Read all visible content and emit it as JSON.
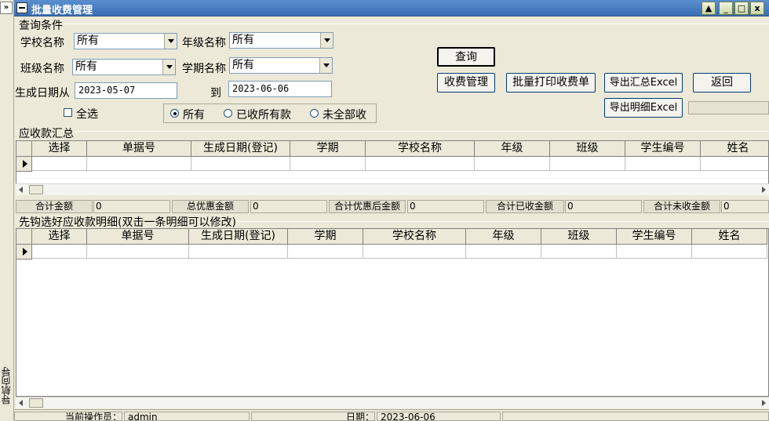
{
  "window": {
    "title": "批量收费管理",
    "nav_label": "导航向导",
    "nav_button": "»",
    "min": "_",
    "restore": "□",
    "close": "x",
    "help": "▲"
  },
  "query": {
    "section_label": "查询条件",
    "school_label": "学校名称",
    "school_value": "所有",
    "grade_label": "年级名称",
    "grade_value": "所有",
    "class_label": "班级名称",
    "class_value": "所有",
    "term_label": "学期名称",
    "term_value": "所有",
    "date_from_label": "生成日期从",
    "date_from": "2023-05-07",
    "date_to_label": "到",
    "date_to": "2023-06-06",
    "select_all": "全选",
    "radios": [
      "所有",
      "已收所有款",
      "未全部收"
    ]
  },
  "buttons": {
    "query": "查询",
    "fee_manage": "收费管理",
    "batch_print": "批量打印收费单",
    "export_summary": "导出汇总Excel",
    "back": "返回",
    "export_detail": "导出明细Excel"
  },
  "summary": {
    "section_label": "应收款汇总",
    "columns": [
      "选择",
      "单据号",
      "生成日期(登记)",
      "学期",
      "学校名称",
      "年级",
      "班级",
      "学生编号",
      "姓名"
    ]
  },
  "totals": [
    {
      "label": "合计金额",
      "value": "0"
    },
    {
      "label": "总优惠金额",
      "value": "0"
    },
    {
      "label": "合计优惠后金额",
      "value": "0"
    },
    {
      "label": "合计已收金额",
      "value": "0"
    },
    {
      "label": "合计未收金额",
      "value": "0"
    }
  ],
  "detail": {
    "section_label": "先钩选好应收款明细(双击一条明细可以修改)",
    "columns": [
      "选择",
      "单据号",
      "生成日期(登记)",
      "学期",
      "学校名称",
      "年级",
      "班级",
      "学生编号",
      "姓名"
    ]
  },
  "status": {
    "operator_label": "当前操作员：",
    "operator": "admin",
    "date_label": "日期：",
    "date": "2023-06-06"
  },
  "colors": {
    "title_bar": "#3a6fb4",
    "window_bg": "#ece9d8"
  }
}
